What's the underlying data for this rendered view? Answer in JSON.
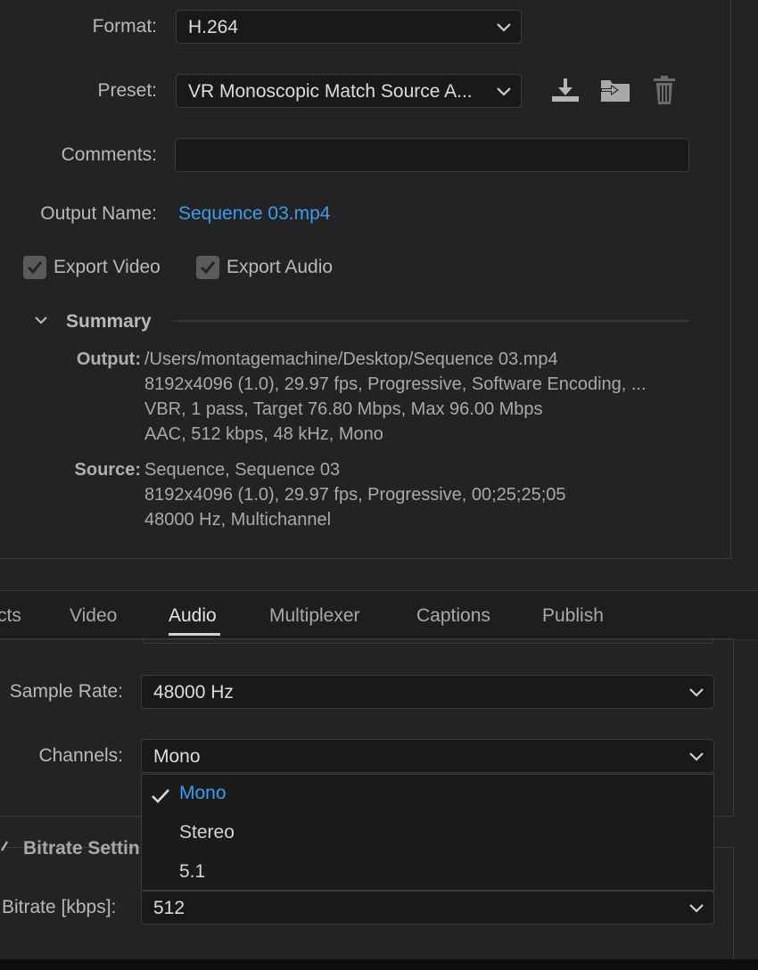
{
  "export_settings": {
    "format_label": "Format:",
    "format_value": "H.264",
    "preset_label": "Preset:",
    "preset_value": "VR Monoscopic Match Source A...",
    "comments_label": "Comments:",
    "comments_value": "",
    "output_name_label": "Output Name:",
    "output_name_value": "Sequence 03.mp4",
    "export_video_label": "Export Video",
    "export_audio_label": "Export Audio",
    "export_video_checked": true,
    "export_audio_checked": true
  },
  "summary": {
    "title": "Summary",
    "output_label": "Output:",
    "output_lines": [
      "/Users/montagemachine/Desktop/Sequence 03.mp4",
      "8192x4096 (1.0), 29.97 fps, Progressive, Software Encoding, ...",
      "VBR, 1 pass, Target 76.80 Mbps, Max 96.00 Mbps",
      "AAC, 512 kbps, 48 kHz, Mono"
    ],
    "source_label": "Source:",
    "source_lines": [
      "Sequence, Sequence 03",
      "8192x4096 (1.0), 29.97 fps, Progressive, 00;25;25;05",
      "48000 Hz, Multichannel"
    ]
  },
  "tabs": [
    {
      "label": "cts",
      "active": false
    },
    {
      "label": "Video",
      "active": false
    },
    {
      "label": "Audio",
      "active": true
    },
    {
      "label": "Multiplexer",
      "active": false
    },
    {
      "label": "Captions",
      "active": false
    },
    {
      "label": "Publish",
      "active": false
    }
  ],
  "audio": {
    "sample_rate_label": "Sample Rate:",
    "sample_rate_value": "48000 Hz",
    "channels_label": "Channels:",
    "channels_value": "Mono",
    "channels_options": [
      "Mono",
      "Stereo",
      "5.1"
    ],
    "channels_selected": "Mono",
    "bitrate_section_title": "Bitrate Settin",
    "bitrate_label": "Bitrate [kbps]:",
    "bitrate_value": "512"
  },
  "colors": {
    "background": "#232323",
    "accent_blue": "#3b9cf0",
    "field_bg": "#191919"
  },
  "icons": [
    "save-preset-icon",
    "import-preset-icon",
    "delete-preset-icon",
    "chevron-down-icon",
    "checkmark-icon"
  ]
}
